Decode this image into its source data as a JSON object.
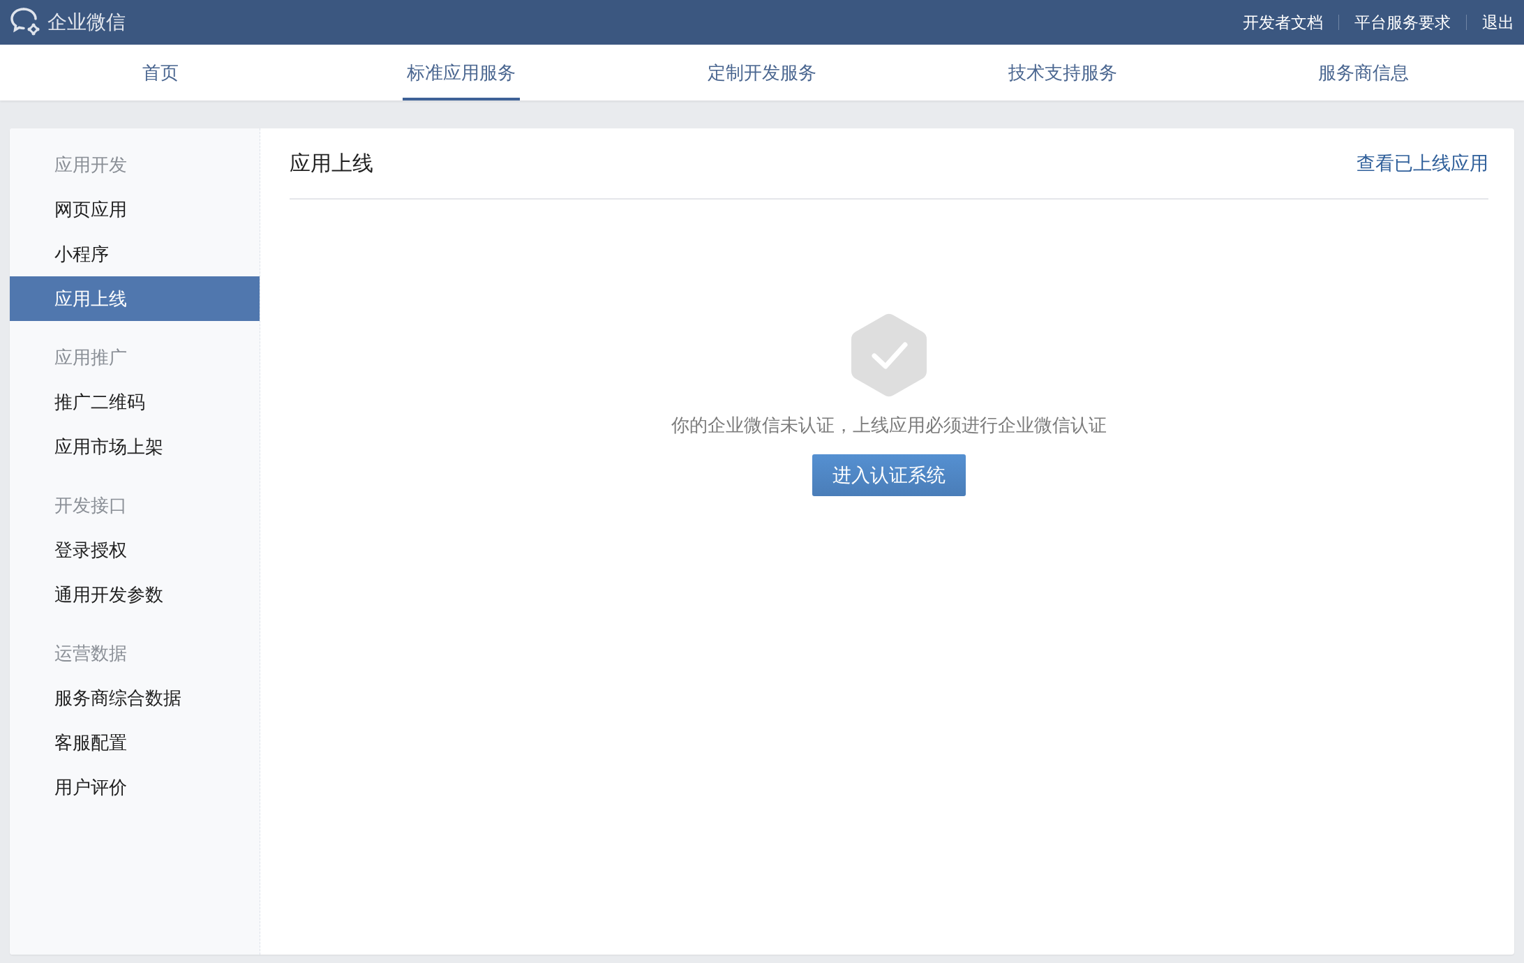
{
  "header": {
    "logo_text": "企业微信",
    "links": [
      "开发者文档",
      "平台服务要求",
      "退出"
    ]
  },
  "tabs": [
    {
      "label": "首页",
      "selected": false
    },
    {
      "label": "标准应用服务",
      "selected": true
    },
    {
      "label": "定制开发服务",
      "selected": false
    },
    {
      "label": "技术支持服务",
      "selected": false
    },
    {
      "label": "服务商信息",
      "selected": false
    }
  ],
  "sidebar": {
    "groups": [
      {
        "title": "应用开发",
        "items": [
          {
            "label": "网页应用",
            "selected": false
          },
          {
            "label": "小程序",
            "selected": false
          },
          {
            "label": "应用上线",
            "selected": true
          }
        ]
      },
      {
        "title": "应用推广",
        "items": [
          {
            "label": "推广二维码",
            "selected": false
          },
          {
            "label": "应用市场上架",
            "selected": false
          }
        ]
      },
      {
        "title": "开发接口",
        "items": [
          {
            "label": "登录授权",
            "selected": false
          },
          {
            "label": "通用开发参数",
            "selected": false
          }
        ]
      },
      {
        "title": "运营数据",
        "items": [
          {
            "label": "服务商综合数据",
            "selected": false
          },
          {
            "label": "客服配置",
            "selected": false
          },
          {
            "label": "用户评价",
            "selected": false
          }
        ]
      }
    ]
  },
  "content": {
    "title": "应用上线",
    "link": "查看已上线应用",
    "message": "你的企业微信未认证，上线应用必须进行企业微信认证",
    "button": "进入认证系统"
  }
}
